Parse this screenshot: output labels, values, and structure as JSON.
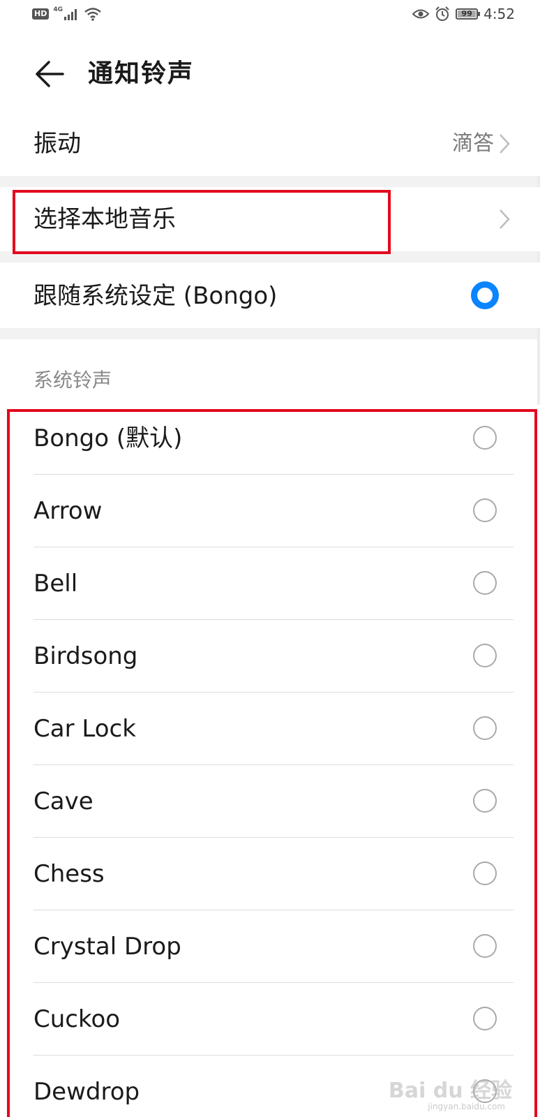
{
  "status_bar": {
    "hd": "HD",
    "network": "4G",
    "battery": "99",
    "battery_level": 0.99,
    "time": "4:52",
    "icons": [
      "signal-icon",
      "wifi-icon",
      "eye-icon",
      "alarm-icon",
      "battery-icon"
    ]
  },
  "header": {
    "title": "通知铃声",
    "back_icon": "arrow-left-icon"
  },
  "settings": {
    "vibration": {
      "label": "振动",
      "value": "滴答"
    },
    "local_music": {
      "label": "选择本地音乐"
    },
    "follow_system": {
      "label": "跟随系统设定 (Bongo)",
      "selected": true
    }
  },
  "section": {
    "title": "系统铃声"
  },
  "ringtones": [
    {
      "label": "Bongo (默认)",
      "selected": false
    },
    {
      "label": "Arrow",
      "selected": false
    },
    {
      "label": "Bell",
      "selected": false
    },
    {
      "label": "Birdsong",
      "selected": false
    },
    {
      "label": "Car Lock",
      "selected": false
    },
    {
      "label": "Cave",
      "selected": false
    },
    {
      "label": "Chess",
      "selected": false
    },
    {
      "label": "Crystal Drop",
      "selected": false
    },
    {
      "label": "Cuckoo",
      "selected": false
    },
    {
      "label": "Dewdrop",
      "selected": false
    }
  ],
  "watermark": {
    "text": "Bai du 经验",
    "sub": "jingyan.baidu.com"
  },
  "colors": {
    "accent": "#0a84ff",
    "highlight": "#e3081e",
    "divider": "#dcdcdc"
  }
}
